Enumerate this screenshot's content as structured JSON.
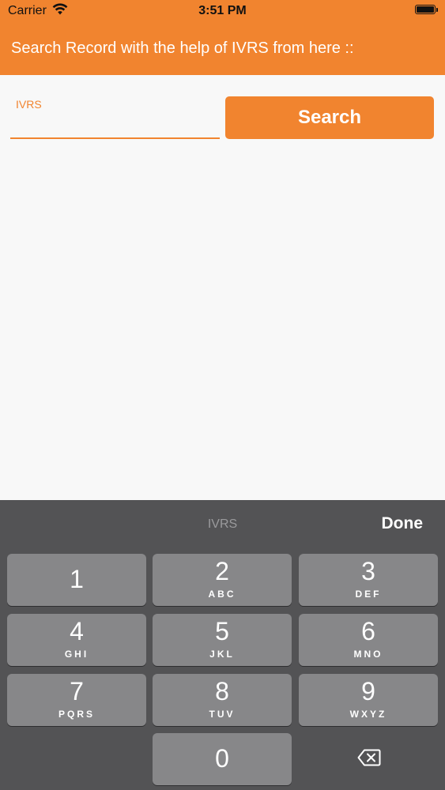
{
  "status_bar": {
    "carrier": "Carrier",
    "time": "3:51 PM",
    "wifi_icon": "wifi-icon",
    "battery_icon": "battery-icon"
  },
  "header": {
    "title": "Search Record with the help of IVRS from here ::"
  },
  "form": {
    "ivrs_label": "IVRS",
    "ivrs_value": "",
    "search_button": "Search"
  },
  "keyboard": {
    "field_name": "IVRS",
    "done_label": "Done",
    "keys": [
      {
        "digit": "1",
        "letters": ""
      },
      {
        "digit": "2",
        "letters": "ABC"
      },
      {
        "digit": "3",
        "letters": "DEF"
      },
      {
        "digit": "4",
        "letters": "GHI"
      },
      {
        "digit": "5",
        "letters": "JKL"
      },
      {
        "digit": "6",
        "letters": "MNO"
      },
      {
        "digit": "7",
        "letters": "PQRS"
      },
      {
        "digit": "8",
        "letters": "TUV"
      },
      {
        "digit": "9",
        "letters": "WXYZ"
      },
      {
        "digit": "0",
        "letters": ""
      }
    ],
    "delete_icon": "delete-icon"
  },
  "colors": {
    "accent": "#f1842f",
    "keyboard_bg": "#535355",
    "key_bg": "#878789"
  }
}
